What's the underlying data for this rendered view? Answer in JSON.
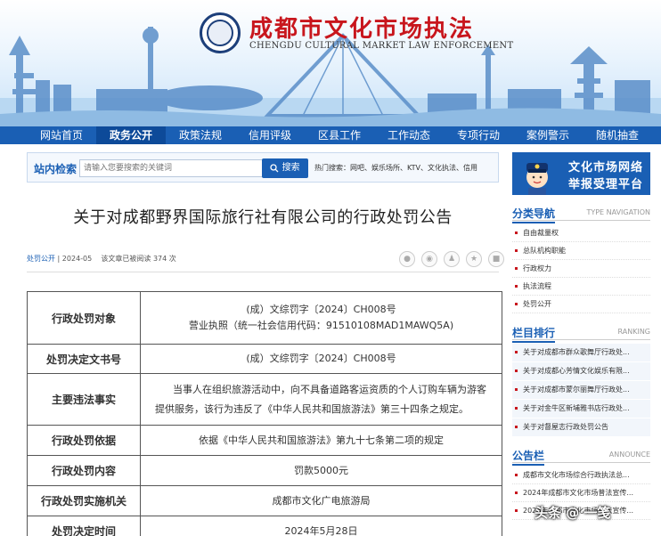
{
  "header": {
    "title": "成都市文化市场执法",
    "subtitle": "CHENGDU CULTURAL MARKET LAW ENFORCEMENT"
  },
  "nav": [
    "网站首页",
    "政务公开",
    "政策法规",
    "信用评级",
    "区县工作",
    "工作动态",
    "专项行动",
    "案例警示",
    "随机抽查"
  ],
  "search": {
    "label": "站内检索",
    "placeholder": "请输入您要搜索的关键词",
    "button": "搜索",
    "hot": "热门搜索：网吧、娱乐场所、KTV、文化执法、信用"
  },
  "report": {
    "line1": "文化市场网络",
    "line2": "举报受理平台"
  },
  "article": {
    "title": "关于对成都野界国际旅行社有限公司的行政处罚公告",
    "category": "处罚公开",
    "date": "2024-05",
    "views": "该文章已被阅读 374 次"
  },
  "table": [
    {
      "label": "行政处罚对象",
      "value": "(成）文综罚字〔2024〕CH008号",
      "value2": "营业执照（统一社会信用代码：91510108MAD1MAWQ5A)"
    },
    {
      "label": "处罚决定文书号",
      "value": "(成）文综罚字〔2024〕CH008号"
    },
    {
      "label": "主要违法事实",
      "value": "当事人在组织旅游活动中，向不具备道路客运资质的个人订购车辆为游客提供服务，该行为违反了《中华人民共和国旅游法》第三十四条之规定。"
    },
    {
      "label": "行政处罚依据",
      "value": "依据《中华人民共和国旅游法》第九十七条第二项的规定"
    },
    {
      "label": "行政处罚内容",
      "value": "罚款5000元"
    },
    {
      "label": "行政处罚实施机关",
      "value": "成都市文化广电旅游局"
    },
    {
      "label": "处罚决定时间",
      "value": "2024年5月28日"
    }
  ],
  "sidebar": {
    "nav": {
      "title": "分类导航",
      "en": "TYPE NAVIGATION",
      "items": [
        "自由裁量权",
        "总队机构职能",
        "行政权力",
        "执法流程",
        "处罚公开"
      ]
    },
    "rank": {
      "title": "栏目排行",
      "en": "RANKING",
      "items": [
        "关于对成都市群众歌舞厅行政处...",
        "关于对成都心芳情文化娱乐有限...",
        "关于对成都市蒙尔丽舞厅行政处...",
        "关于对金牛区新埔雅书店行政处...",
        "关于对督屋志行政处罚公告"
      ]
    },
    "notice": {
      "title": "公告栏",
      "en": "ANNOUNCE",
      "items": [
        "成都市文化市场综合行政执法总...",
        "2024年成都市文化市场普法宣传...",
        "2024年成都市文化市场普法宣传..."
      ]
    }
  },
  "watermark": "头条 @ 一笺"
}
